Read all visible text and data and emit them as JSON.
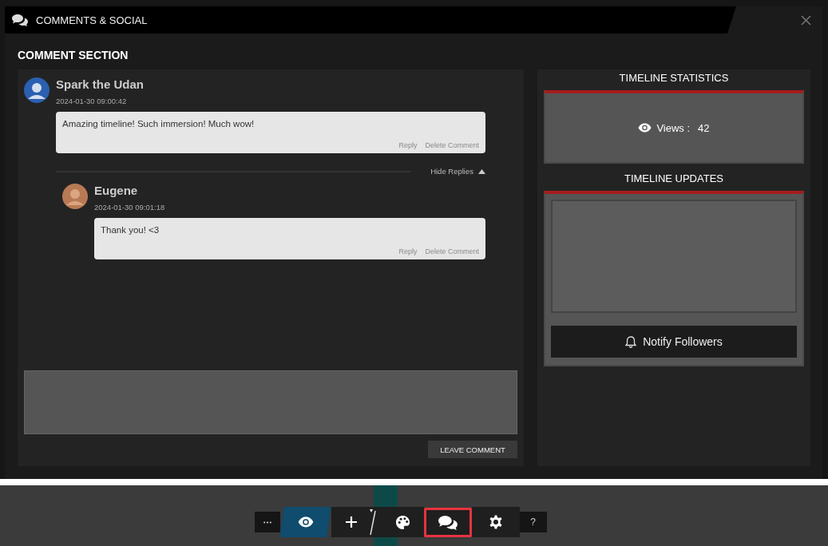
{
  "window": {
    "title": "COMMENTS & SOCIAL"
  },
  "comment_section": {
    "title": "COMMENT SECTION",
    "comments": [
      {
        "author": "Spark the Udan",
        "timestamp": "2024-01-30 09:00:42",
        "text": "Amazing timeline! Such immersion! Much wow!",
        "actions": [
          "Reply",
          "Delete Comment"
        ],
        "replies_toggle": "Hide Replies",
        "expanded": true,
        "children": [
          {
            "author": "Eugene",
            "timestamp": "2024-01-30 09:01:18",
            "text": "Thank you! <3",
            "actions": [
              "Reply",
              "Delete Comment"
            ]
          }
        ]
      }
    ],
    "submit_button": "LEAVE COMMENT"
  },
  "statistics": {
    "title": "TIMELINE STATISTICS",
    "views_label": "Views :",
    "views_value": "42"
  },
  "updates": {
    "title": "TIMELINE UPDATES",
    "notify_button": "Notify Followers"
  },
  "toolbar": [
    {
      "kind": "more",
      "selected": false,
      "highlighted": false
    },
    {
      "kind": "view",
      "selected": true,
      "highlighted": false
    },
    {
      "kind": "add",
      "selected": false,
      "highlighted": false
    },
    {
      "kind": "palette",
      "selected": false,
      "highlighted": false
    },
    {
      "kind": "comments",
      "selected": false,
      "highlighted": true
    },
    {
      "kind": "settings",
      "selected": false,
      "highlighted": false
    },
    {
      "kind": "help",
      "label": "?",
      "selected": false,
      "highlighted": false
    }
  ]
}
